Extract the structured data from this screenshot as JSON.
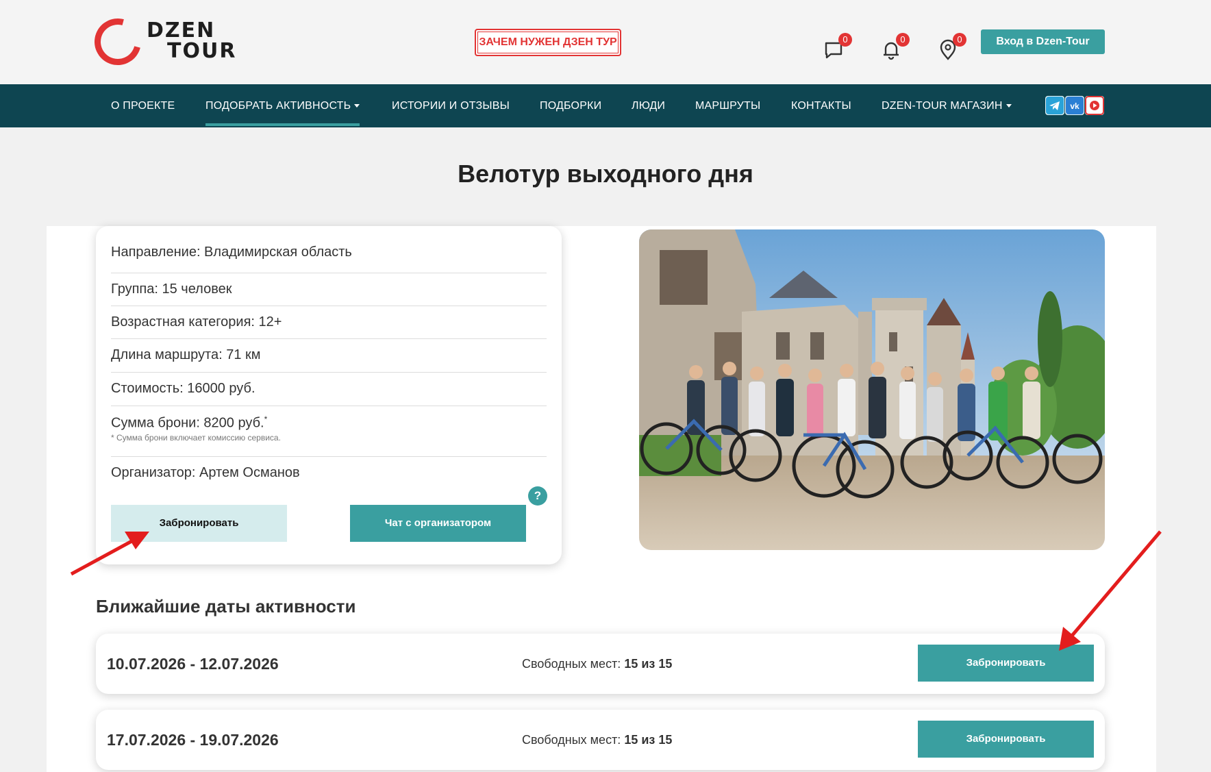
{
  "header": {
    "logo_line1": "DZEN",
    "logo_line2": "TOUR",
    "why_button": "ЗАЧЕМ НУЖЕН ДЗЕН ТУР",
    "messages_count": "0",
    "notifications_count": "0",
    "places_count": "0",
    "login_button": "Вход в Dzen-Tour"
  },
  "nav": {
    "items": [
      {
        "label": "О ПРОЕКТЕ"
      },
      {
        "label": "ПОДОБРАТЬ АКТИВНОСТЬ",
        "dropdown": true,
        "active": true
      },
      {
        "label": "ИСТОРИИ И ОТЗЫВЫ"
      },
      {
        "label": "ПОДБОРКИ"
      },
      {
        "label": "ЛЮДИ"
      },
      {
        "label": "МАРШРУТЫ"
      },
      {
        "label": "КОНТАКТЫ"
      },
      {
        "label": "DZEN-TOUR МАГАЗИН",
        "dropdown": true
      }
    ],
    "social": [
      "telegram-icon",
      "vk-icon",
      "video-icon"
    ]
  },
  "page": {
    "title": "Велотур выходного дня"
  },
  "info": {
    "direction": "Направление: Владимирская область",
    "group": "Группа: 15 человек",
    "age": "Возрастная категория: 12+",
    "length": "Длина маршрута: 71 км",
    "price": "Стоимость: 16000 руб.",
    "deposit": "Сумма брони: 8200 руб.",
    "deposit_mark": "*",
    "deposit_note": "* Сумма брони включает комиссию сервиса.",
    "organizer": "Организатор: Артем Османов",
    "help": "?",
    "book_button": "Забронировать",
    "chat_button": "Чат с организатором"
  },
  "dates": {
    "title": "Ближайшие даты активности",
    "seats_label": "Свободных мест:",
    "items": [
      {
        "range": "10.07.2026 - 12.07.2026",
        "seats": "15 из 15",
        "button": "Забронировать"
      },
      {
        "range": "17.07.2026 - 19.07.2026",
        "seats": "15 из 15",
        "button": "Забронировать"
      }
    ]
  },
  "colors": {
    "nav_bg": "#0e4551",
    "accent": "#3a9fa0",
    "brand_red": "#e23434",
    "book_light": "#d5eced"
  }
}
